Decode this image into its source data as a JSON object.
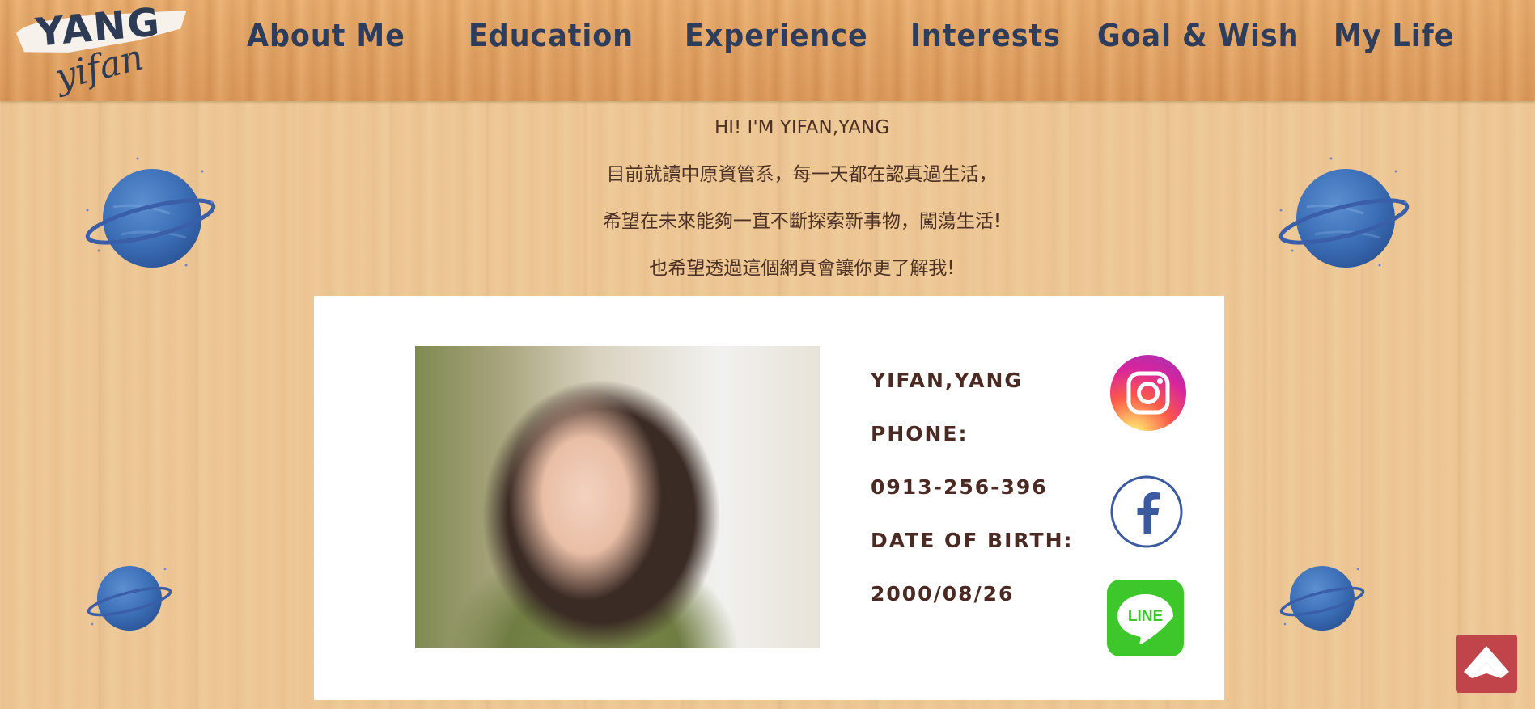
{
  "logo": {
    "line1": "YANG",
    "line2": "yifan"
  },
  "nav": {
    "items": [
      {
        "label": "About Me"
      },
      {
        "label": "Education"
      },
      {
        "label": "Experience"
      },
      {
        "label": "Interests"
      },
      {
        "label": "Goal & Wish"
      },
      {
        "label": "My Life"
      }
    ]
  },
  "intro": {
    "greeting": "HI!  I'M YIFAN,YANG",
    "line1": "目前就讀中原資管系，每一天都在認真過生活，",
    "line2": "希望在未來能夠一直不斷探索新事物，闖蕩生活!",
    "line3": "也希望透過這個網頁會讓你更了解我!"
  },
  "profile": {
    "name": "YIFAN,YANG",
    "phone_label": "PHONE:",
    "phone": "0913-256-396",
    "dob_label": "DATE OF BIRTH:",
    "dob": "2000/08/26"
  },
  "social": {
    "instagram": {
      "icon": "instagram-icon"
    },
    "facebook": {
      "icon": "facebook-icon",
      "glyph": "f"
    },
    "line": {
      "icon": "line-icon",
      "label": "LINE"
    }
  },
  "colors": {
    "nav_text": "#2f3d5c",
    "body_text": "#4d3124",
    "back_to_top": "#c2444b",
    "line_green": "#3ec72a",
    "facebook_blue": "#3b5aa0"
  }
}
